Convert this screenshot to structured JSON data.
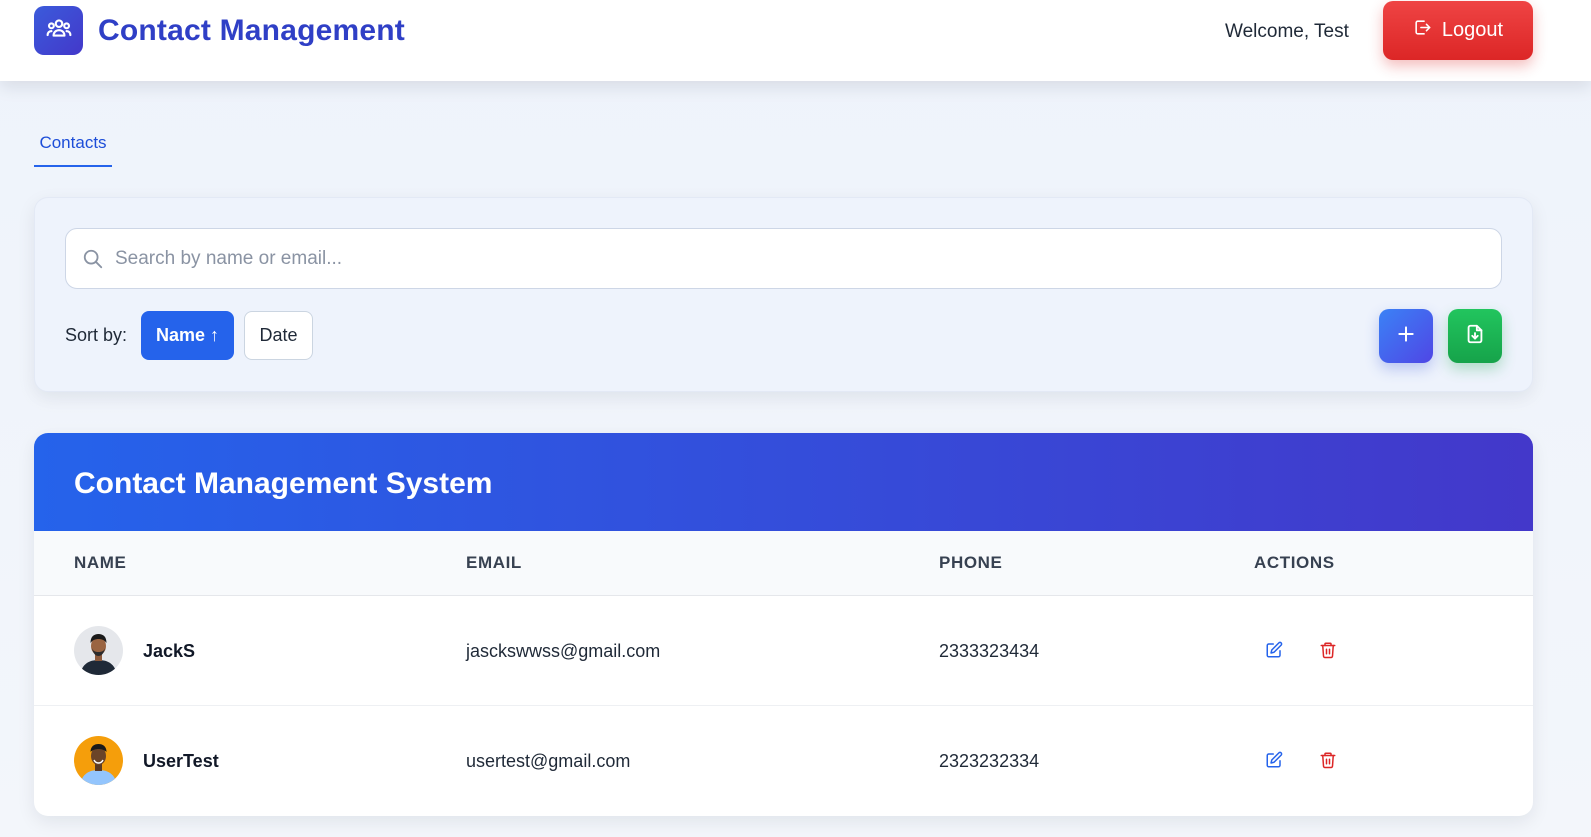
{
  "header": {
    "app_title": "Contact Management",
    "welcome_text": "Welcome, Test",
    "logout_label": "Logout"
  },
  "tabs": [
    {
      "label": "Contacts",
      "active": true
    }
  ],
  "filters": {
    "search_placeholder": "Search by name or email...",
    "search_value": "",
    "sort_label": "Sort by:",
    "sort_options": [
      {
        "label": "Name ↑",
        "active": true
      },
      {
        "label": "Date",
        "active": false
      }
    ],
    "add_icon": "plus-icon",
    "export_icon": "file-download-icon"
  },
  "table": {
    "title": "Contact Management System",
    "columns": [
      "NAME",
      "EMAIL",
      "PHONE",
      "ACTIONS"
    ],
    "rows": [
      {
        "name": "JackS",
        "email": "jasckswwss@gmail.com",
        "phone": "2333323434"
      },
      {
        "name": "UserTest",
        "email": "usertest@gmail.com",
        "phone": "2323232334"
      }
    ]
  },
  "colors": {
    "primary": "#2563eb",
    "header_gradient_end": "#4338ca",
    "danger": "#dc2626",
    "success": "#16a34a"
  }
}
